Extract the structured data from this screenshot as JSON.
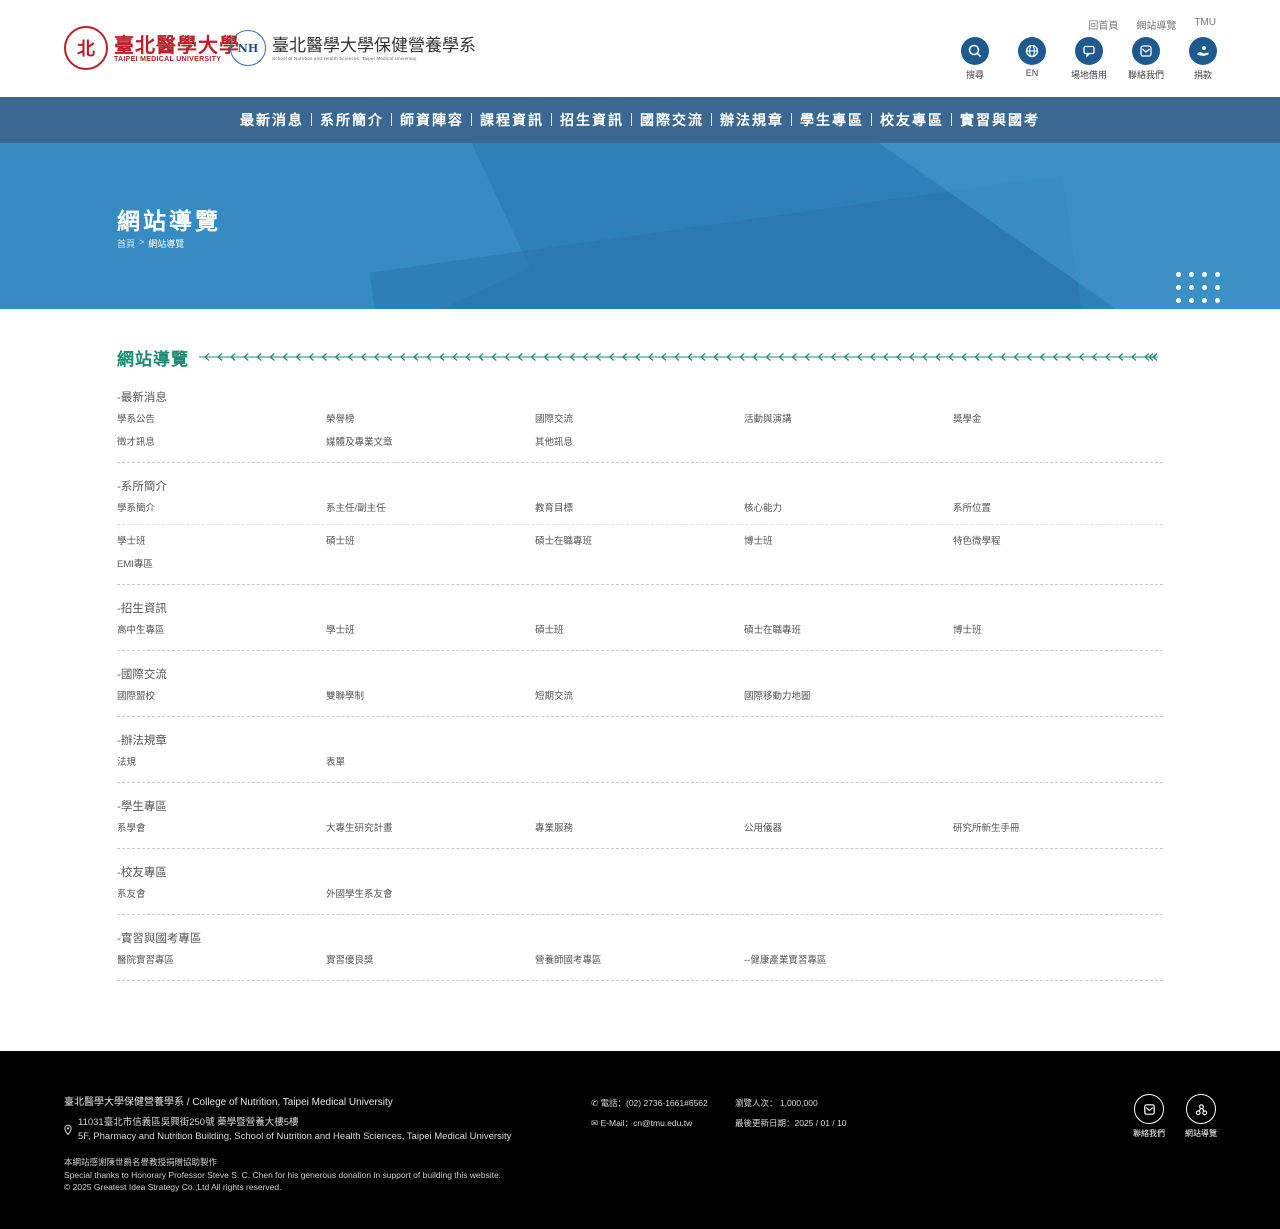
{
  "brand": {
    "tmu_seal": "北",
    "tmu_name_cn": "臺北醫學大學",
    "tmu_name_en": "TAIPEI MEDICAL UNIVERSITY",
    "nh_mark": "NH",
    "nh_name_cn": "臺北醫學大學保健營養學系",
    "nh_name_en": "School of Nutrition and Health Sciences, Taipei Medical University"
  },
  "toplinks": [
    "回首頁",
    "網站導覽",
    "TMU"
  ],
  "iconbar": [
    {
      "label": "搜尋",
      "icon": "search-icon"
    },
    {
      "label": "EN",
      "icon": "globe-icon"
    },
    {
      "label": "場地借用",
      "icon": "chat-icon"
    },
    {
      "label": "聯絡我們",
      "icon": "mail-icon"
    },
    {
      "label": "捐款",
      "icon": "donate-icon"
    }
  ],
  "nav": [
    "最新消息",
    "系所簡介",
    "師資陣容",
    "課程資訊",
    "招生資訊",
    "國際交流",
    "辦法規章",
    "學生專區",
    "校友專區",
    "實習與國考"
  ],
  "banner": {
    "title": "網站導覽",
    "breadcrumb_home": "首頁",
    "breadcrumb_sep": ">",
    "breadcrumb_current": "網站導覽"
  },
  "section_title": "網站導覽",
  "groups": [
    {
      "title": "-最新消息",
      "rows": [
        [
          "學系公告",
          "榮譽榜",
          "國際交流",
          "活動與演講",
          "獎學金",
          "徵才訊息",
          "媒體及專業文章",
          "其他訊息"
        ]
      ]
    },
    {
      "title": "-系所簡介",
      "rows": [
        [
          "學系簡介",
          "系主任/副主任",
          "教育目標",
          "核心能力",
          "系所位置"
        ],
        [
          "學士班",
          "碩士班",
          "碩士在職專班",
          "博士班",
          "特色微學程",
          "EMI專區"
        ]
      ]
    },
    {
      "title": "-招生資訊",
      "rows": [
        [
          "高中生專區",
          "學士班",
          "碩士班",
          "碩士在職專班",
          "博士班"
        ]
      ]
    },
    {
      "title": "-國際交流",
      "rows": [
        [
          "國際盟校",
          "雙聯學制",
          "短期交流",
          "國際移動力地圖"
        ]
      ]
    },
    {
      "title": "-辦法規章",
      "rows": [
        [
          "法規",
          "表單"
        ]
      ]
    },
    {
      "title": "-學生專區",
      "rows": [
        [
          "系學會",
          "大專生研究計畫",
          "專業服務",
          "公用儀器",
          "研究所新生手冊"
        ]
      ]
    },
    {
      "title": "-校友專區",
      "rows": [
        [
          "系友會",
          "外國學生系友會"
        ]
      ]
    },
    {
      "title": "-實習與國考專區",
      "rows": [
        [
          "醫院實習專區",
          "實習優良獎",
          "營養師國考專區",
          "--健康產業實習專區"
        ]
      ]
    }
  ],
  "footer": {
    "org": "臺北醫學大學保健營養學系 / College of Nutrition, Taipei Medical University",
    "address_cn": "11031臺北市信義區吳興街250號 藥學暨營養大樓5樓",
    "address_en": "5F, Pharmacy and Nutrition Building, School of Nutrition and Health Sciences, Taipei Medical University",
    "credit_cn": "本網站感謝陳世爵名譽教授捐贈協助製作",
    "credit_en": "Special thanks to Honorary Professor Steve S. C. Chen for his generous donation in support of building this website.",
    "copyright": "© 2025 Greatest Idea Strategy Co.,Ltd All rights reserved.",
    "phone": "電話：(02) 2736-1661#6562",
    "email": "E-Mail：cn@tmu.edu.tw",
    "visitors": "瀏覽人次： 1,000,000",
    "updated": "最後更新日期：2025 / 01 / 10",
    "icon_contact": "聯絡我們",
    "icon_sitemap": "網站導覽"
  }
}
